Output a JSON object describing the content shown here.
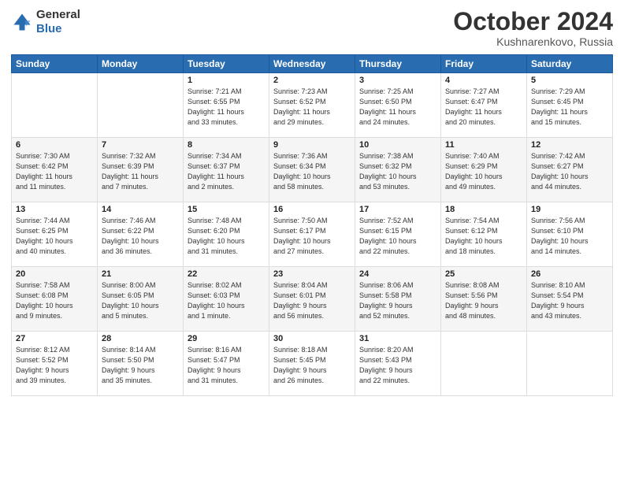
{
  "header": {
    "logo_general": "General",
    "logo_blue": "Blue",
    "month_title": "October 2024",
    "location": "Kushnarenkovo, Russia"
  },
  "days_of_week": [
    "Sunday",
    "Monday",
    "Tuesday",
    "Wednesday",
    "Thursday",
    "Friday",
    "Saturday"
  ],
  "weeks": [
    [
      {
        "day": "",
        "info": ""
      },
      {
        "day": "",
        "info": ""
      },
      {
        "day": "1",
        "info": "Sunrise: 7:21 AM\nSunset: 6:55 PM\nDaylight: 11 hours\nand 33 minutes."
      },
      {
        "day": "2",
        "info": "Sunrise: 7:23 AM\nSunset: 6:52 PM\nDaylight: 11 hours\nand 29 minutes."
      },
      {
        "day": "3",
        "info": "Sunrise: 7:25 AM\nSunset: 6:50 PM\nDaylight: 11 hours\nand 24 minutes."
      },
      {
        "day": "4",
        "info": "Sunrise: 7:27 AM\nSunset: 6:47 PM\nDaylight: 11 hours\nand 20 minutes."
      },
      {
        "day": "5",
        "info": "Sunrise: 7:29 AM\nSunset: 6:45 PM\nDaylight: 11 hours\nand 15 minutes."
      }
    ],
    [
      {
        "day": "6",
        "info": "Sunrise: 7:30 AM\nSunset: 6:42 PM\nDaylight: 11 hours\nand 11 minutes."
      },
      {
        "day": "7",
        "info": "Sunrise: 7:32 AM\nSunset: 6:39 PM\nDaylight: 11 hours\nand 7 minutes."
      },
      {
        "day": "8",
        "info": "Sunrise: 7:34 AM\nSunset: 6:37 PM\nDaylight: 11 hours\nand 2 minutes."
      },
      {
        "day": "9",
        "info": "Sunrise: 7:36 AM\nSunset: 6:34 PM\nDaylight: 10 hours\nand 58 minutes."
      },
      {
        "day": "10",
        "info": "Sunrise: 7:38 AM\nSunset: 6:32 PM\nDaylight: 10 hours\nand 53 minutes."
      },
      {
        "day": "11",
        "info": "Sunrise: 7:40 AM\nSunset: 6:29 PM\nDaylight: 10 hours\nand 49 minutes."
      },
      {
        "day": "12",
        "info": "Sunrise: 7:42 AM\nSunset: 6:27 PM\nDaylight: 10 hours\nand 44 minutes."
      }
    ],
    [
      {
        "day": "13",
        "info": "Sunrise: 7:44 AM\nSunset: 6:25 PM\nDaylight: 10 hours\nand 40 minutes."
      },
      {
        "day": "14",
        "info": "Sunrise: 7:46 AM\nSunset: 6:22 PM\nDaylight: 10 hours\nand 36 minutes."
      },
      {
        "day": "15",
        "info": "Sunrise: 7:48 AM\nSunset: 6:20 PM\nDaylight: 10 hours\nand 31 minutes."
      },
      {
        "day": "16",
        "info": "Sunrise: 7:50 AM\nSunset: 6:17 PM\nDaylight: 10 hours\nand 27 minutes."
      },
      {
        "day": "17",
        "info": "Sunrise: 7:52 AM\nSunset: 6:15 PM\nDaylight: 10 hours\nand 22 minutes."
      },
      {
        "day": "18",
        "info": "Sunrise: 7:54 AM\nSunset: 6:12 PM\nDaylight: 10 hours\nand 18 minutes."
      },
      {
        "day": "19",
        "info": "Sunrise: 7:56 AM\nSunset: 6:10 PM\nDaylight: 10 hours\nand 14 minutes."
      }
    ],
    [
      {
        "day": "20",
        "info": "Sunrise: 7:58 AM\nSunset: 6:08 PM\nDaylight: 10 hours\nand 9 minutes."
      },
      {
        "day": "21",
        "info": "Sunrise: 8:00 AM\nSunset: 6:05 PM\nDaylight: 10 hours\nand 5 minutes."
      },
      {
        "day": "22",
        "info": "Sunrise: 8:02 AM\nSunset: 6:03 PM\nDaylight: 10 hours\nand 1 minute."
      },
      {
        "day": "23",
        "info": "Sunrise: 8:04 AM\nSunset: 6:01 PM\nDaylight: 9 hours\nand 56 minutes."
      },
      {
        "day": "24",
        "info": "Sunrise: 8:06 AM\nSunset: 5:58 PM\nDaylight: 9 hours\nand 52 minutes."
      },
      {
        "day": "25",
        "info": "Sunrise: 8:08 AM\nSunset: 5:56 PM\nDaylight: 9 hours\nand 48 minutes."
      },
      {
        "day": "26",
        "info": "Sunrise: 8:10 AM\nSunset: 5:54 PM\nDaylight: 9 hours\nand 43 minutes."
      }
    ],
    [
      {
        "day": "27",
        "info": "Sunrise: 8:12 AM\nSunset: 5:52 PM\nDaylight: 9 hours\nand 39 minutes."
      },
      {
        "day": "28",
        "info": "Sunrise: 8:14 AM\nSunset: 5:50 PM\nDaylight: 9 hours\nand 35 minutes."
      },
      {
        "day": "29",
        "info": "Sunrise: 8:16 AM\nSunset: 5:47 PM\nDaylight: 9 hours\nand 31 minutes."
      },
      {
        "day": "30",
        "info": "Sunrise: 8:18 AM\nSunset: 5:45 PM\nDaylight: 9 hours\nand 26 minutes."
      },
      {
        "day": "31",
        "info": "Sunrise: 8:20 AM\nSunset: 5:43 PM\nDaylight: 9 hours\nand 22 minutes."
      },
      {
        "day": "",
        "info": ""
      },
      {
        "day": "",
        "info": ""
      }
    ]
  ]
}
